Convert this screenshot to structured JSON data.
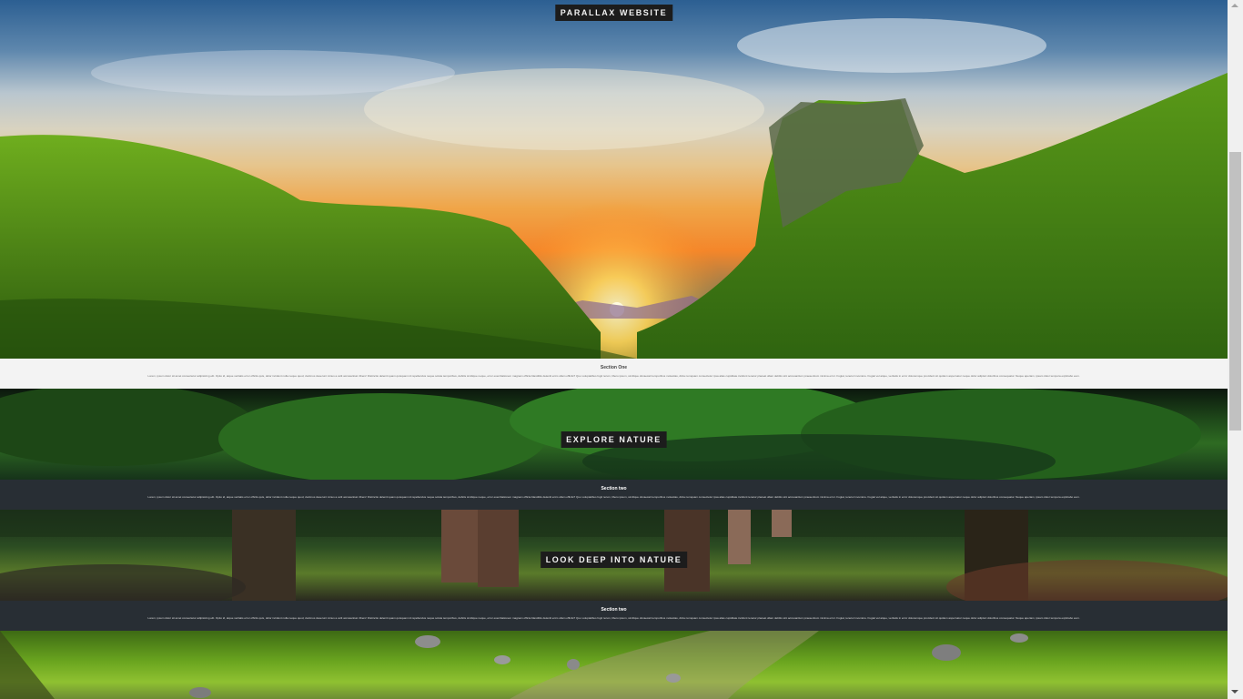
{
  "hero": {
    "caption": "PARALLAX WEBSITE"
  },
  "section_one": {
    "title": "Section One",
    "text": "Lorem, ipsum dolor sit amet consectetur adipisicing elit. Optio id, atque veritatis error officiis quis, dolor incidunt nulla neque quod, ducimus deserunt minus a velit accusantium libero! Distinctio deleniti quam quisquam id repellendus neque soluta temporibus, debitis similique neque, error exercitationem magnam officia blanditiis deleniti enim ullam officiis? Quo voluptatibus fugit rerum, libero ipsum, similique obcaecati temporibus molestias, dicta numquam consectetur ipsa alias cupiditate incidunt tenetur placeat ullam debitis sint accusantium praesentium minima error. Fugiat, tenetur inventore. Fugiat vel atque, veritatis in error doloremque provident sit quidem aspernatur neque dolor adipisci doloribus consequatur. Neque aperiam, ipsam dolor tempora explicabo eum."
  },
  "forest": {
    "caption": "EXPLORE NATURE"
  },
  "section_two": {
    "title": "Section two",
    "text": "Lorem, ipsum dolor sit amet consectetur adipisicing elit. Optio id, atque veritatis error officiis quis, dolor incidunt nulla neque quod, ducimus deserunt minus a velit accusantium libero! Distinctio deleniti quam quisquam id repellendus neque soluta temporibus, debitis similique neque, error exercitationem magnam officia blanditiis deleniti enim ullam officiis? Quo voluptatibus fugit rerum, libero ipsum, similique obcaecati temporibus molestias, dicta numquam consectetur ipsa alias cupiditate incidunt tenetur placeat ullam debitis sint accusantium praesentium minima error. Fugiat, tenetur inventore. Fugiat vel atque, veritatis in error doloremque provident sit quidem aspernatur neque dolor adipisci doloribus consequatur. Neque aperiam, ipsam dolor tempora explicabo eum."
  },
  "deep": {
    "caption": "LOOK DEEP INTO NATURE"
  },
  "section_three": {
    "title": "Section two",
    "text": "Lorem, ipsum dolor sit amet consectetur adipisicing elit. Optio id, atque veritatis error officiis quis, dolor incidunt nulla neque quod, ducimus deserunt minus a velit accusantium libero! Distinctio deleniti quam quisquam id repellendus neque soluta temporibus, debitis similique neque, error exercitationem magnam officia blanditiis deleniti enim ullam officiis? Quo voluptatibus fugit rerum, libero ipsum, similique obcaecati temporibus molestias, dicta numquam consectetur ipsa alias cupiditate incidunt tenetur placeat ullam debitis sint accusantium praesentium minima error. Fugiat, tenetur inventore. Fugiat vel atque, veritatis in error doloremque provident sit quidem aspernatur neque dolor adipisci doloribus consequatur. Neque aperiam, ipsam dolor tempora explicabo eum."
  },
  "colors": {
    "caption_bg": "#1c1c1c",
    "light_section_bg": "#f3f3f3",
    "dark_section_bg": "#282e34"
  }
}
